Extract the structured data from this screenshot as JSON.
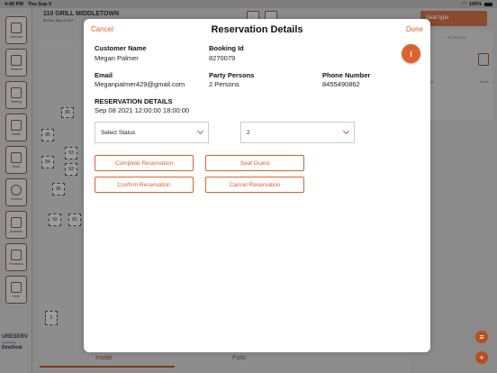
{
  "status_bar": {
    "time": "4:45 PM",
    "date": "Thu Sep 9",
    "wifi": "wifi",
    "battery": "100%"
  },
  "header": {
    "restaurant": "110 GRILL MIDDLETOWN",
    "date_line": "09,Thu Sep 21 Gri"
  },
  "seat_dropdown": {
    "label": "Seat type"
  },
  "right_panel": {
    "sessions_label": "SESSIONS",
    "col_all": "All",
    "col_block": "Block",
    "col_max": "Max"
  },
  "sidebar": {
    "items": [
      {
        "label": "Calendar"
      },
      {
        "label": "Reserve"
      },
      {
        "label": "Waiting"
      },
      {
        "label": "Walkin"
      },
      {
        "label": "Book"
      },
      {
        "label": "Timeline"
      },
      {
        "label": "Available"
      },
      {
        "label": "Feedback"
      },
      {
        "label": "Help"
      }
    ],
    "brand_name": "URESERV",
    "brand_sub": "Powered by",
    "brand_dd": "DineDesk"
  },
  "tables": [
    "86",
    "85",
    "93",
    "84",
    "93",
    "85",
    "92",
    "81",
    "2"
  ],
  "bottom_tabs": {
    "inside": "Inside",
    "patio": "Patio"
  },
  "modal": {
    "cancel": "Cancel",
    "title": "Reservation Details",
    "done": "Done",
    "info_icon": "i",
    "customer_name_label": "Customer Name",
    "customer_name": "Megan Palmer",
    "booking_id_label": "Booking Id",
    "booking_id": "8270079",
    "email_label": "Email",
    "email": "Meganpalmer429@gmail.com",
    "party_label": "Party Persons",
    "party": "2 Persons",
    "phone_label": "Phone Number",
    "phone": "8455490862",
    "res_details_label": "RESERVATION DETAILS",
    "res_details": "Sep 08 2021 12:00:00  18:00:00",
    "status_select": "Select Status",
    "party_select": "2",
    "btn_complete": "Complete Reservation",
    "btn_seat": "Seat Guest",
    "btn_confirm": "Confirm Reservation",
    "btn_cancel": "Cancel Reservation"
  },
  "colors": {
    "accent": "#e0612b",
    "overlay": "#8a8a8a"
  }
}
